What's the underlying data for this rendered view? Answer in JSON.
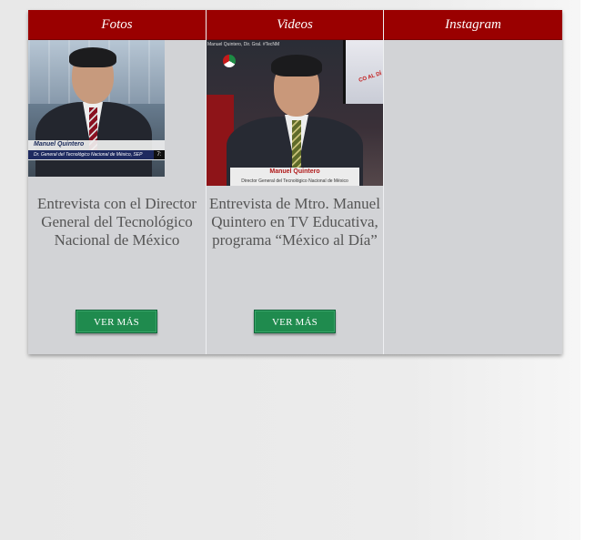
{
  "tabs": [
    {
      "label": "Fotos"
    },
    {
      "label": "Videos"
    },
    {
      "label": "Instagram"
    }
  ],
  "fotos": {
    "thumbnail": {
      "overlay_name": "Manuel Quintero",
      "overlay_title": "Dr. General del Tecnológico Nacional de México, SEP",
      "overlay_time": "7:"
    },
    "description": "Entrevista con el Director General del Tecnológico Nacional de México",
    "button_label": "VER MÁS"
  },
  "videos": {
    "thumbnail": {
      "overlay_caption": "Manuel Quintero, Dir. Gral. #TecNM",
      "screen_text": "CO AL DÍ",
      "overlay_name": "Manuel Quintero",
      "overlay_title": "Director General del Tecnológico Nacional de México"
    },
    "description": "Entrevista de Mtro. Manuel Quintero en TV Educativa, programa “México al Día”",
    "button_label": "VER MÁS"
  },
  "colors": {
    "header": "#9a0000",
    "panel": "#d2d3d6",
    "button": "#1f8b4e",
    "text": "#555555"
  }
}
